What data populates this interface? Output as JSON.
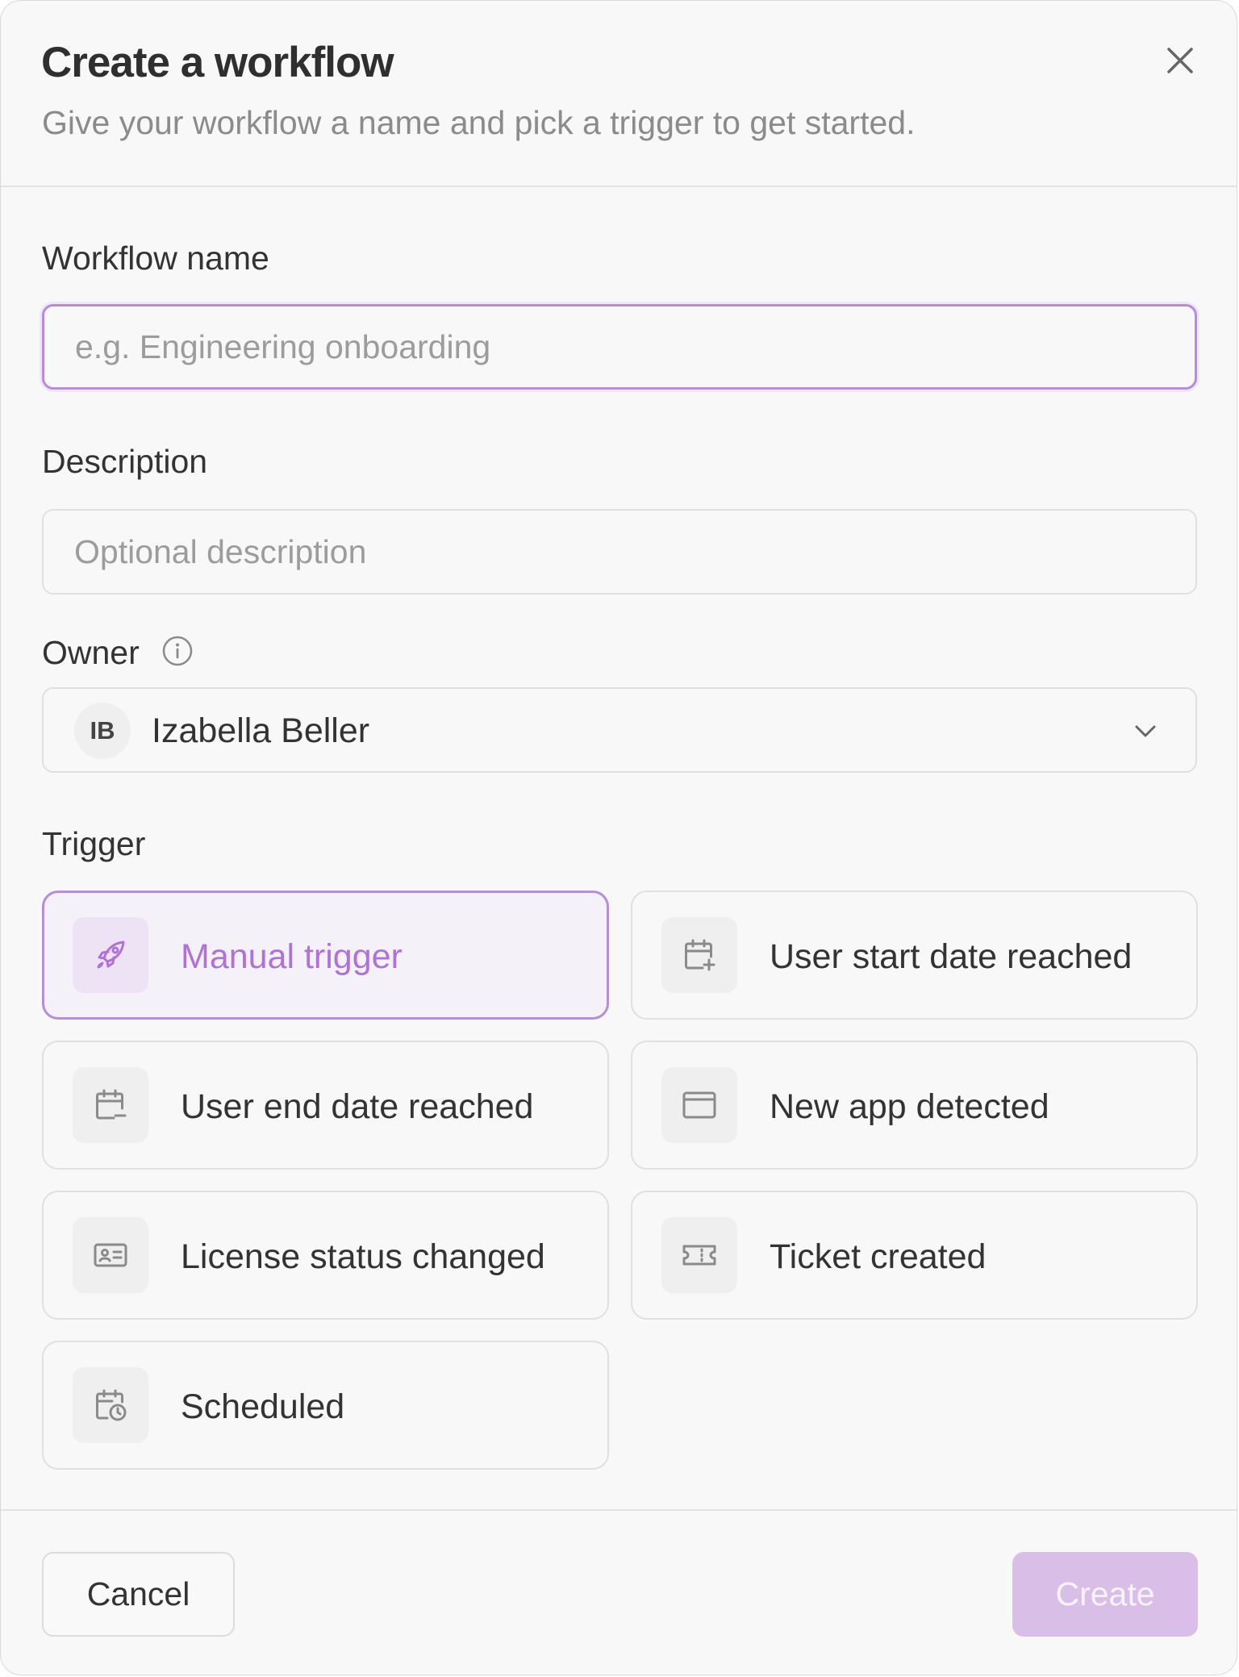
{
  "header": {
    "title": "Create a workflow",
    "subtitle": "Give your workflow a name and pick a trigger to get started."
  },
  "fields": {
    "name_label": "Workflow name",
    "name_placeholder": "e.g. Engineering onboarding",
    "name_value": "",
    "description_label": "Description",
    "description_placeholder": "Optional description",
    "description_value": "",
    "owner_label": "Owner",
    "owner_initials": "IB",
    "owner_name": "Izabella Beller"
  },
  "trigger": {
    "label": "Trigger",
    "selected": "Manual trigger",
    "options": [
      {
        "label": "Manual trigger",
        "icon": "rocket-icon"
      },
      {
        "label": "User start date reached",
        "icon": "calendar-plus-icon"
      },
      {
        "label": "User end date reached",
        "icon": "calendar-minus-icon"
      },
      {
        "label": "New app detected",
        "icon": "app-window-icon"
      },
      {
        "label": "License status changed",
        "icon": "id-card-icon"
      },
      {
        "label": "Ticket created",
        "icon": "ticket-icon"
      },
      {
        "label": "Scheduled",
        "icon": "calendar-clock-icon"
      }
    ]
  },
  "footer": {
    "cancel_label": "Cancel",
    "create_label": "Create"
  },
  "colors": {
    "accent": "#b072d8",
    "accent_border": "#b48ddf",
    "create_disabled_bg": "#d9bfe8"
  }
}
